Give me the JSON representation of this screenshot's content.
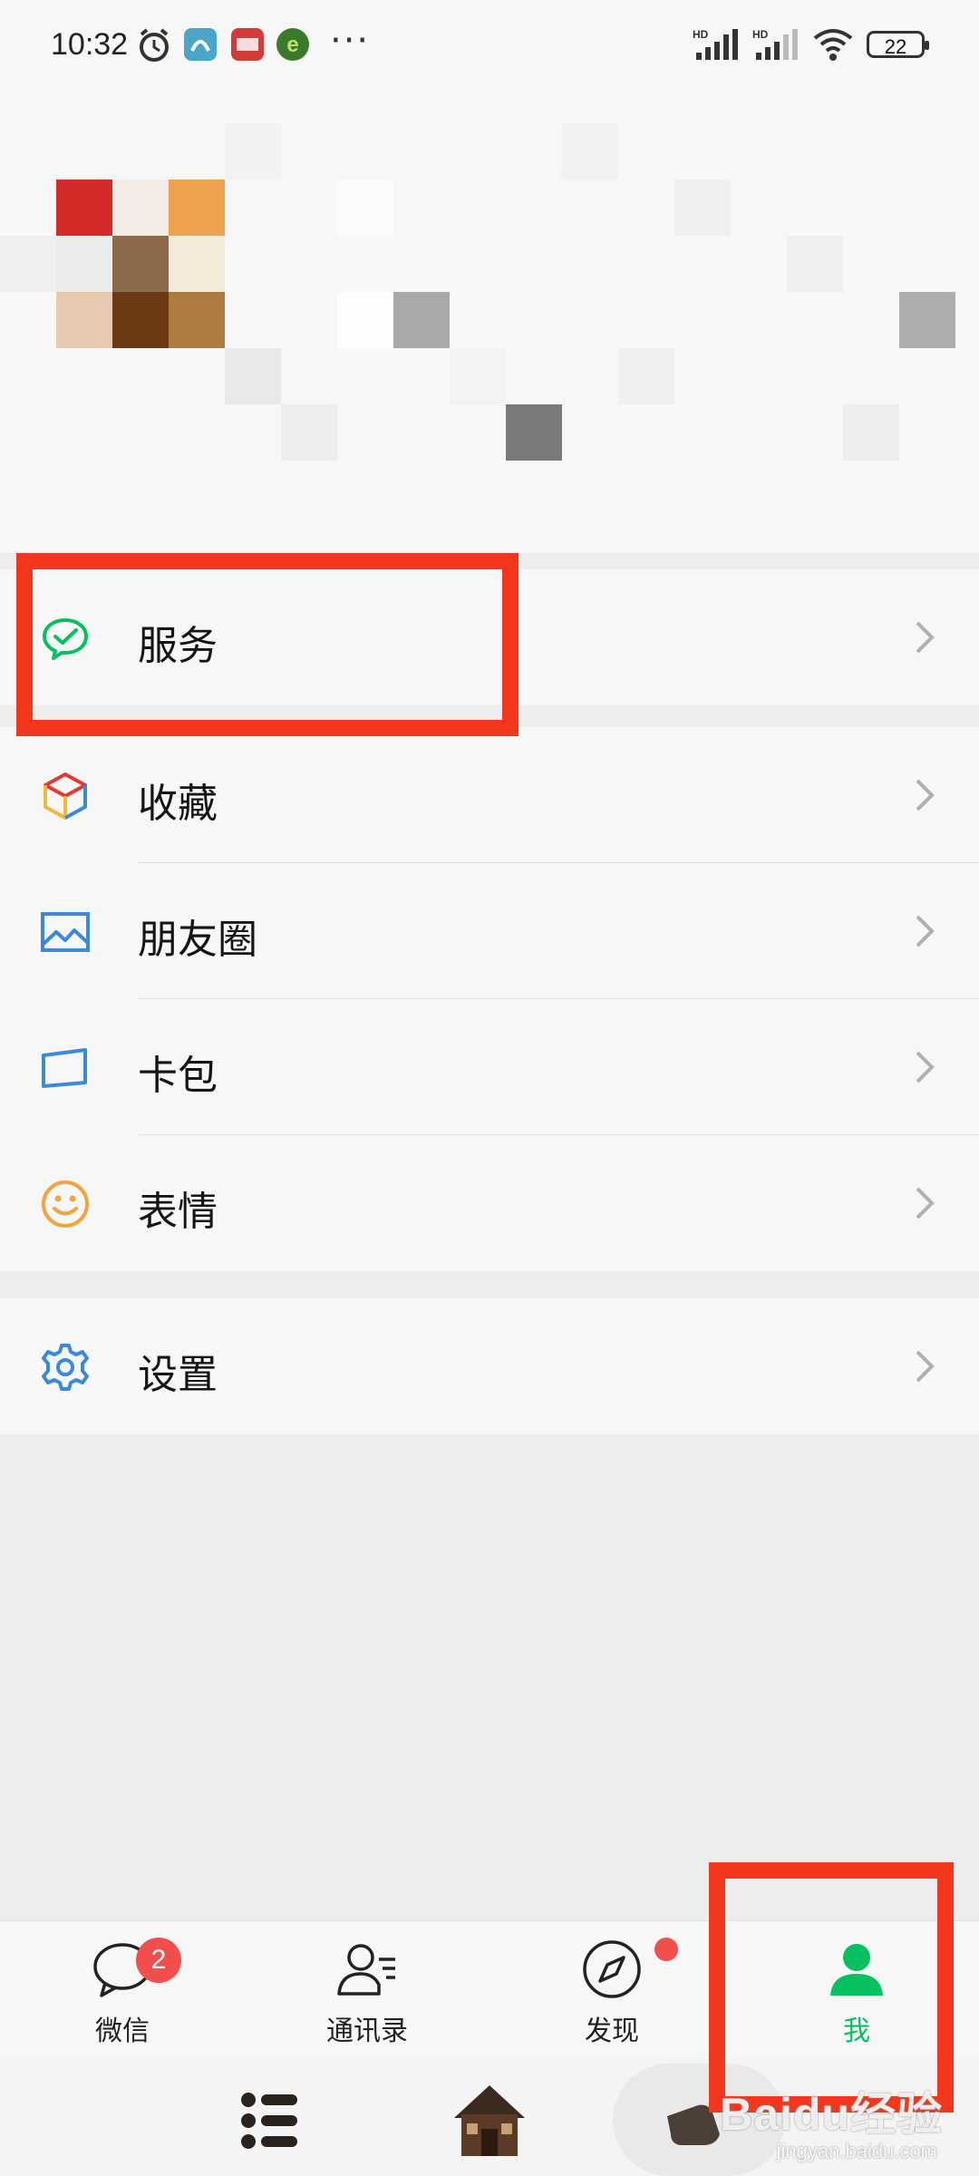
{
  "status_bar": {
    "time": "10:32",
    "battery": "22",
    "notification_icons": [
      "alarm-icon",
      "app-icon-1",
      "app-icon-toutiao",
      "app-icon-green"
    ],
    "more": "···"
  },
  "menu": {
    "services": {
      "label": "服务",
      "icon": "wechat-pay-icon"
    },
    "favorites": {
      "label": "收藏",
      "icon": "cube-icon"
    },
    "moments": {
      "label": "朋友圈",
      "icon": "picture-icon"
    },
    "cards": {
      "label": "卡包",
      "icon": "card-icon"
    },
    "stickers": {
      "label": "表情",
      "icon": "smiley-icon"
    },
    "settings": {
      "label": "设置",
      "icon": "gear-icon"
    }
  },
  "tabbar": {
    "chats": {
      "label": "微信",
      "badge": "2"
    },
    "contacts": {
      "label": "通讯录"
    },
    "discover": {
      "label": "发现"
    },
    "me": {
      "label": "我"
    }
  },
  "watermark": {
    "text": "Baidu经验",
    "sub": "jingyan.baidu.com"
  },
  "colors": {
    "accent_green": "#07c160",
    "highlight_red": "#f2371c",
    "badge_red": "#f24e4e"
  }
}
